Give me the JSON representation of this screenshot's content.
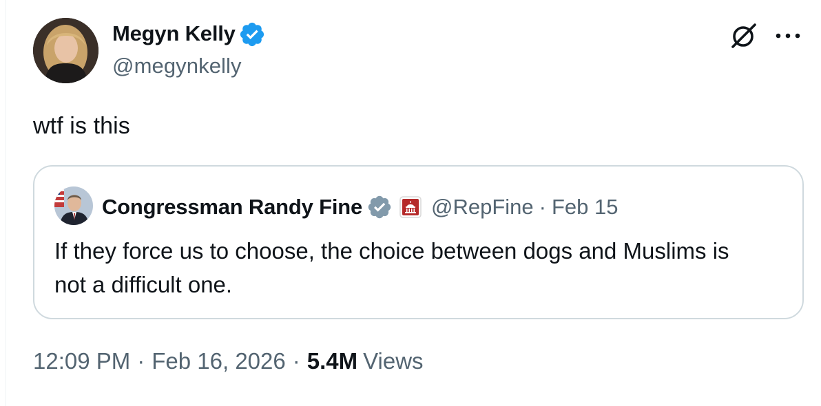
{
  "tweet": {
    "author_name": "Megyn Kelly",
    "author_handle": "@megynkelly",
    "text": "wtf is this",
    "time": "12:09 PM",
    "date": "Feb 16, 2026",
    "views_count": "5.4M",
    "views_label": "Views"
  },
  "quoted": {
    "author_name": "Congressman Randy Fine",
    "author_handle": "@RepFine",
    "date": "Feb 15",
    "text": "If they force us to choose, the choice between dogs and Muslims is not a difficult one."
  },
  "separator": "·",
  "icons": {
    "verified_blue": "verified-badge-icon",
    "verified_gray": "verified-gray-badge-icon",
    "affiliation": "us-house-affiliation-icon",
    "grok": "grok-icon",
    "more": "more-options-icon"
  },
  "colors": {
    "text_primary": "#0f1419",
    "text_secondary": "#536471",
    "border": "#cfd9de",
    "verified_blue": "#1d9bf0",
    "verified_gray": "#829aab",
    "affiliation_red": "#b52a2a"
  }
}
